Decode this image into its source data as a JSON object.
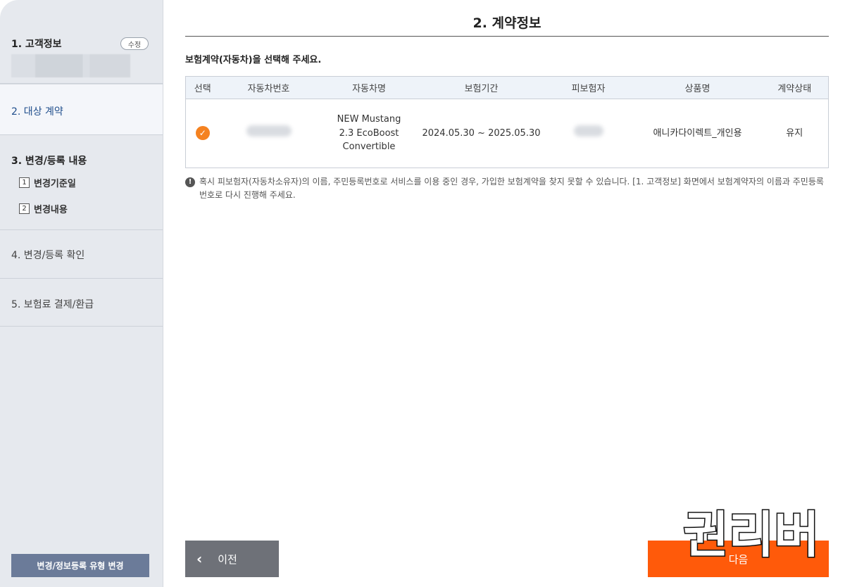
{
  "sidebar": {
    "step1": {
      "title": "1. 고객정보",
      "edit_label": "수정"
    },
    "step2": {
      "title": "2. 대상 계약"
    },
    "step3": {
      "title": "3. 변경/등록 내용",
      "subs": [
        {
          "num": "1",
          "label": "변경기준일"
        },
        {
          "num": "2",
          "label": "변경내용"
        }
      ]
    },
    "step4": {
      "title": "4. 변경/등록 확인"
    },
    "step5": {
      "title": "5. 보험료 결제/환급"
    },
    "bottom_button": "변경/정보등록 유형 변경"
  },
  "main": {
    "title": "2. 계약정보",
    "instruction": "보험계약(자동차)을 선택해 주세요.",
    "table": {
      "headers": [
        "선택",
        "자동차번호",
        "자동차명",
        "보험기간",
        "피보험자",
        "상품명",
        "계약상태"
      ],
      "rows": [
        {
          "car_name": "NEW Mustang 2.3 EcoBoost Convertible",
          "period": "2024.05.30 ~ 2025.05.30",
          "product": "애니카다이렉트_개인용",
          "status": "유지"
        }
      ]
    },
    "notice": "혹시 피보험자(자동차소유자)의 이름, 주민등록번호로 서비스를 이용 중인 경우, 가입한 보험계약을 찾지 못할 수 있습니다. [1. 고객정보] 화면에서 보험계약자의 이름과 주민등록번호로 다시 진행해 주세요."
  },
  "footer": {
    "prev_label": "이전",
    "next_label": "다음"
  },
  "watermark": {
    "text": "권리버"
  },
  "icons": {
    "check": "check-circle-icon",
    "notice": "exclamation-circle-icon",
    "prev": "chevron-left-icon"
  },
  "colors": {
    "accent": "#ff5a0a",
    "check": "#f58220",
    "active_text": "#1f4e8c",
    "prev_button": "#6e7178",
    "sidebar_button": "#6b7b99"
  }
}
